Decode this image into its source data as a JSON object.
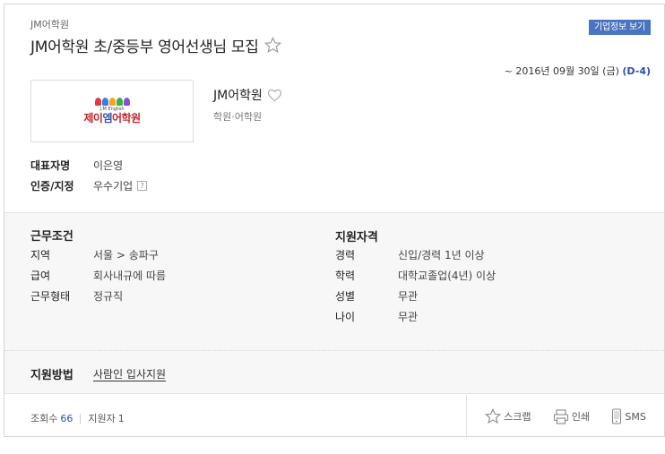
{
  "header": {
    "company_small": "JM어학원",
    "job_title": "JM어학원 초/중등부 영어선생님 모집",
    "company_info_button": "기업정보 보기",
    "deadline_text": "~ 2016년 09월 30일 (금)",
    "dday": "(D-4)"
  },
  "company": {
    "logo_sub": "J.M English",
    "logo_text_red1": "제이",
    "logo_text_blue": "엠",
    "logo_text_red2": "어학원",
    "name": "JM어학원",
    "type": "학원·어학원",
    "ceo_label": "대표자명",
    "ceo_value": "이은영",
    "cert_label": "인증/지정",
    "cert_value": "우수기업",
    "cert_help": "?"
  },
  "conditions": {
    "title": "근무조건",
    "rows": [
      {
        "label": "지역",
        "value": "서울 > 송파구"
      },
      {
        "label": "급여",
        "value": "회사내규에 따름"
      },
      {
        "label": "근무형태",
        "value": "정규직"
      }
    ]
  },
  "qualifications": {
    "title": "지원자격",
    "rows": [
      {
        "label": "경력",
        "value": "신입/경력 1년 이상"
      },
      {
        "label": "학력",
        "value": "대학교졸업(4년) 이상"
      },
      {
        "label": "성별",
        "value": "무관"
      },
      {
        "label": "나이",
        "value": "무관"
      }
    ]
  },
  "apply": {
    "label": "지원방법",
    "method": "사람인 입사지원"
  },
  "footer": {
    "views_label": "조회수",
    "views_value": "66",
    "applicants_label": "지원자",
    "applicants_value": "1",
    "scrap_label": "스크랩",
    "print_label": "인쇄",
    "sms_label": "SMS"
  },
  "colors": {
    "accent_blue": "#4a73c2",
    "dday_blue": "#2a4fb2",
    "logo_red": "#c2262c"
  }
}
